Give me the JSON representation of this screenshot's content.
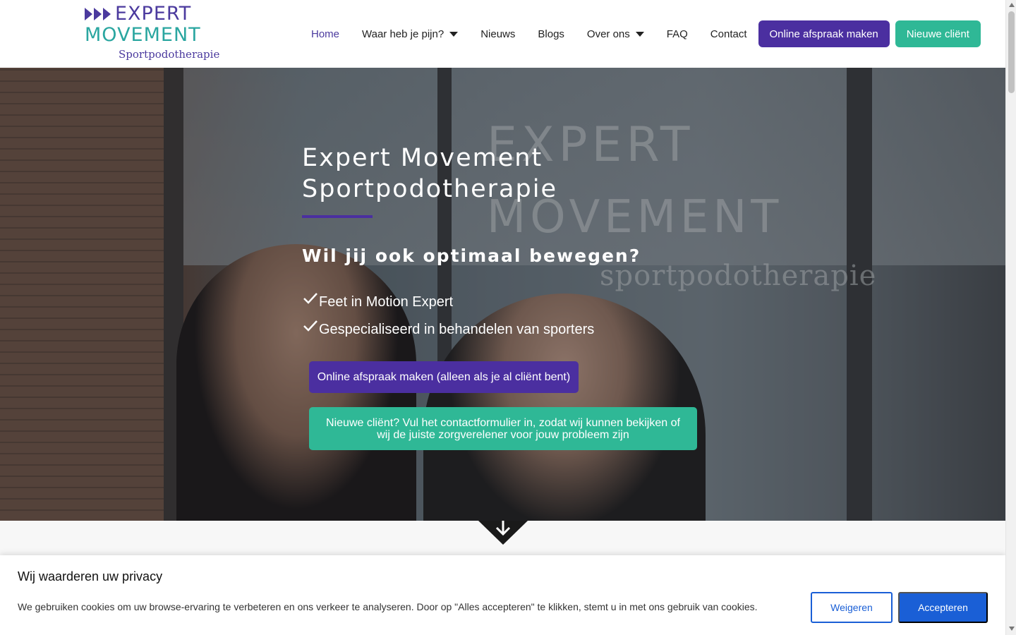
{
  "logo": {
    "word1": "EXPERT",
    "word2": "MOVEMENT",
    "sub": "Sportpodotherapie",
    "colors": {
      "purple": "#4b3a9e",
      "teal": "#2aa6a0"
    }
  },
  "nav": {
    "items": [
      {
        "label": "Home",
        "active": true
      },
      {
        "label": "Waar heb je pijn?",
        "dropdown": true
      },
      {
        "label": "Nieuws"
      },
      {
        "label": "Blogs"
      },
      {
        "label": "Over ons",
        "dropdown": true
      },
      {
        "label": "FAQ"
      },
      {
        "label": "Contact"
      }
    ],
    "cta_primary": "Online afspraak maken",
    "cta_secondary": "Nieuwe cliënt"
  },
  "hero": {
    "title_line1": "Expert Movement",
    "title_line2": "Sportpodotherapie",
    "subtitle": "Wil jij ook optimaal bewegen?",
    "checks": [
      "Feet in Motion Expert",
      "Gespecialiseerd in behandelen van sporters"
    ],
    "button_appointment": "Online afspraak maken (alleen als je al cliënt bent)",
    "button_new_client": "Nieuwe cliënt? Vul het contactformulier in, zodat wij kunnen bekijken of wij de juiste zorgverelener voor jouw probleem zijn",
    "window_text": {
      "word1": "EXPERT",
      "word2": "MOVEMENT",
      "word3": "sportpodotherapie"
    }
  },
  "cookie": {
    "title": "Wij waarderen uw privacy",
    "text": "We gebruiken cookies om uw browse-ervaring te verbeteren en ons verkeer te analyseren. Door op \"Alles accepteren\" te klikken, stemt u in met ons gebruik van cookies.",
    "decline": "Weigeren",
    "accept": "Accepteren"
  },
  "colors": {
    "brand_purple": "#4b2fa0",
    "brand_green": "#2fb896",
    "cookie_blue": "#1a5fd6"
  },
  "icons": {
    "check": "check-icon",
    "caret": "chevron-down-icon",
    "scroll_down": "arrow-down-icon"
  }
}
